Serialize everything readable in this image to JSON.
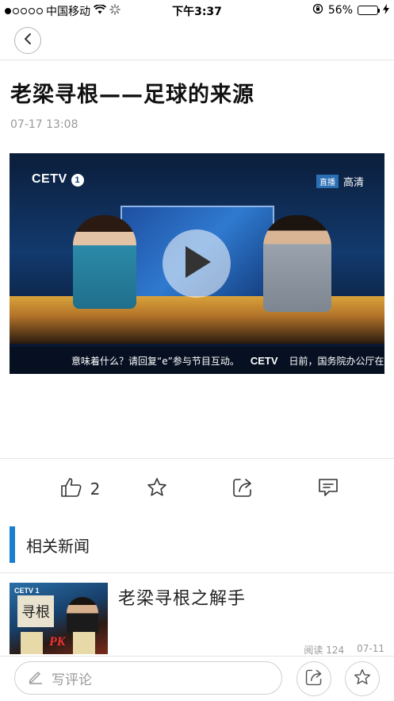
{
  "status_bar": {
    "carrier": "中国移动",
    "time": "下午3:37",
    "battery_percent": "56%",
    "battery_level": 0.56,
    "signal_icon": "signal-dots-icon",
    "wifi_icon": "wifi-icon",
    "loading_icon": "activity-spinner-icon",
    "orientation_lock_icon": "orientation-lock-icon",
    "charging_icon": "charging-bolt-icon"
  },
  "nav": {
    "back_icon": "chevron-left-icon"
  },
  "article": {
    "title": "老梁寻根——足球的来源",
    "time": "07-17 13:08"
  },
  "video": {
    "channel_logo": "CETV",
    "channel_number": "1",
    "badge_live": "直播",
    "badge_hd": "高清",
    "ticker_left": "意味着什么？请回复“e”参与节目互动。",
    "ticker_logo": "CETV",
    "ticker_right": "日前，国务院办公厅在印发",
    "play_icon": "play-icon"
  },
  "actions": {
    "like_icon": "thumbs-up-icon",
    "like_count": "2",
    "favorite_icon": "star-icon",
    "share_icon": "share-icon",
    "comment_icon": "comment-icon"
  },
  "related": {
    "section_title": "相关新闻",
    "items": [
      {
        "title": "老梁寻根之解手",
        "thumb_logo": "CETV 1",
        "thumb_text": "寻根",
        "thumb_pk": "PK",
        "reads": "阅读 124",
        "date": "07-11"
      }
    ]
  },
  "bottom_bar": {
    "comment_placeholder": "写评论",
    "pen_icon": "pen-icon",
    "share_icon": "share-icon",
    "favorite_icon": "star-icon"
  },
  "colors": {
    "accent": "#1a7fd1",
    "battery": "#4cd964",
    "meta_text": "#999999"
  }
}
